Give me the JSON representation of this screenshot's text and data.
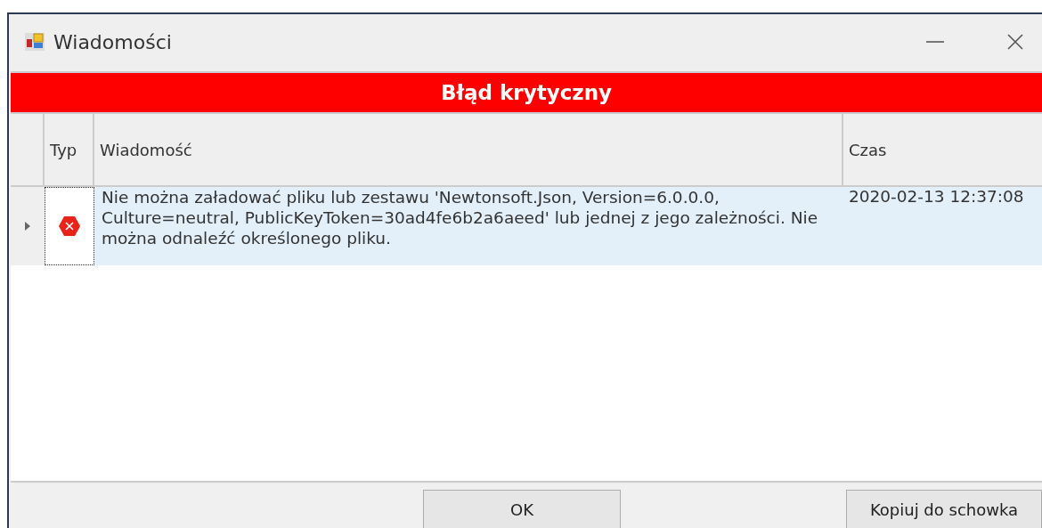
{
  "window": {
    "title": "Wiadomości"
  },
  "banner": {
    "text": "Błąd krytyczny"
  },
  "table": {
    "columns": [
      "Typ",
      "Wiadomość",
      "Czas"
    ],
    "rows": [
      {
        "selected": true,
        "kind": "error",
        "message": "Nie można załadować pliku lub zestawu 'Newtonsoft.Json, Version=6.0.0.0, Culture=neutral, PublicKeyToken=30ad4fe6b2a6aeed' lub jednej z jego zależności. Nie można odnaleźć określonego pliku.",
        "time": "2020-02-13 12:37:08"
      }
    ]
  },
  "buttons": [
    "OK",
    "Kopiuj do schowka"
  ]
}
